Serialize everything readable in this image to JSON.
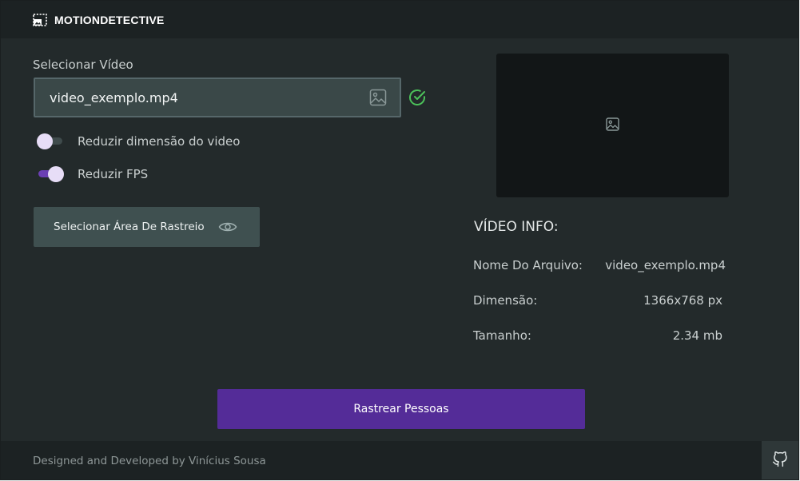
{
  "app": {
    "title": "MOTIONDETECTIVE"
  },
  "video_select": {
    "label": "Selecionar Vídeo",
    "file_value": "video_exemplo.mp4"
  },
  "options": {
    "reduce_dimension": {
      "label": "Reduzir dimensão do video",
      "enabled": false
    },
    "reduce_fps": {
      "label": "Reduzir FPS",
      "enabled": true
    }
  },
  "area_button": {
    "label": "Selecionar Área De Rastreio"
  },
  "video_info": {
    "title": "VÍDEO INFO:",
    "rows": [
      {
        "key": "Nome Do Arquivo:",
        "value": "video_exemplo.mp4"
      },
      {
        "key": "Dimensão:",
        "value": "1366x768 px"
      },
      {
        "key": "Tamanho:",
        "value": "2.34 mb"
      }
    ]
  },
  "track_button": {
    "label": "Rastrear Pessoas"
  },
  "footer": {
    "credit": "Designed and Developed by Vinícius Sousa"
  },
  "colors": {
    "accent": "#542c98",
    "toggle_on": "#6b3fb4",
    "success": "#4cc25a",
    "background": "#232a2b"
  },
  "icons": {
    "app": "image-frame-icon",
    "file_input": "image-icon",
    "status": "check-circle-icon",
    "area_button": "eye-icon",
    "preview": "image-placeholder-icon",
    "footer": "github-icon"
  }
}
